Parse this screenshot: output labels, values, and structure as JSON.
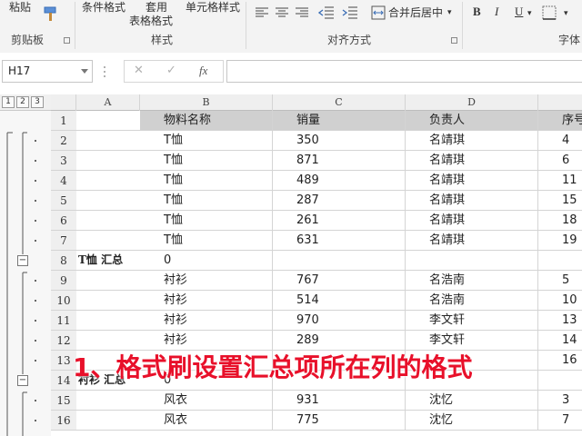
{
  "ribbon": {
    "clipboard": {
      "paste_label": "粘贴",
      "group_label": "剪贴板"
    },
    "styles": {
      "conditional_format": "条件格式",
      "table_format_line1": "套用",
      "table_format_line2": "表格格式",
      "cell_styles": "单元格样式",
      "group_label": "样式"
    },
    "alignment": {
      "merge_center": "合并后居中",
      "group_label": "对齐方式"
    },
    "font": {
      "bold": "B",
      "italic": "I",
      "underline": "U",
      "group_label": "字体"
    }
  },
  "formula_bar": {
    "name_box": "H17",
    "fx_label": "fx",
    "cancel_symbol": "✕",
    "enter_symbol": "✓",
    "formula": ""
  },
  "outline_levels": [
    "1",
    "2",
    "3"
  ],
  "columns": [
    "A",
    "B",
    "C",
    "D",
    ""
  ],
  "rows": [
    {
      "num": "1",
      "a": "",
      "b": "物料名称",
      "c": "销量",
      "d": "负责人",
      "e": "序号",
      "header": true
    },
    {
      "num": "2",
      "a": "",
      "b": "T恤",
      "c": "350",
      "d": "名靖琪",
      "e": "4"
    },
    {
      "num": "3",
      "a": "",
      "b": "T恤",
      "c": "871",
      "d": "名靖琪",
      "e": "6"
    },
    {
      "num": "4",
      "a": "",
      "b": "T恤",
      "c": "489",
      "d": "名靖琪",
      "e": "11"
    },
    {
      "num": "5",
      "a": "",
      "b": "T恤",
      "c": "287",
      "d": "名靖琪",
      "e": "15"
    },
    {
      "num": "6",
      "a": "",
      "b": "T恤",
      "c": "261",
      "d": "名靖琪",
      "e": "18"
    },
    {
      "num": "7",
      "a": "",
      "b": "T恤",
      "c": "631",
      "d": "名靖琪",
      "e": "19"
    },
    {
      "num": "8",
      "a": "T恤 汇总",
      "b": "0",
      "c": "",
      "d": "",
      "e": ""
    },
    {
      "num": "9",
      "a": "",
      "b": "衬衫",
      "c": "767",
      "d": "名浩南",
      "e": "5"
    },
    {
      "num": "10",
      "a": "",
      "b": "衬衫",
      "c": "514",
      "d": "名浩南",
      "e": "10"
    },
    {
      "num": "11",
      "a": "",
      "b": "衬衫",
      "c": "970",
      "d": "李文轩",
      "e": "13"
    },
    {
      "num": "12",
      "a": "",
      "b": "衬衫",
      "c": "289",
      "d": "李文轩",
      "e": "14"
    },
    {
      "num": "13",
      "a": "",
      "b": "",
      "c": "",
      "d": "",
      "e": "16"
    },
    {
      "num": "14",
      "a": "衬衫 汇总",
      "b": "0",
      "c": "",
      "d": "",
      "e": ""
    },
    {
      "num": "15",
      "a": "",
      "b": "风衣",
      "c": "931",
      "d": "沈忆",
      "e": "3"
    },
    {
      "num": "16",
      "a": "",
      "b": "风衣",
      "c": "775",
      "d": "沈忆",
      "e": "7"
    }
  ],
  "caption": "1、格式刷设置汇总项所在列的格式"
}
